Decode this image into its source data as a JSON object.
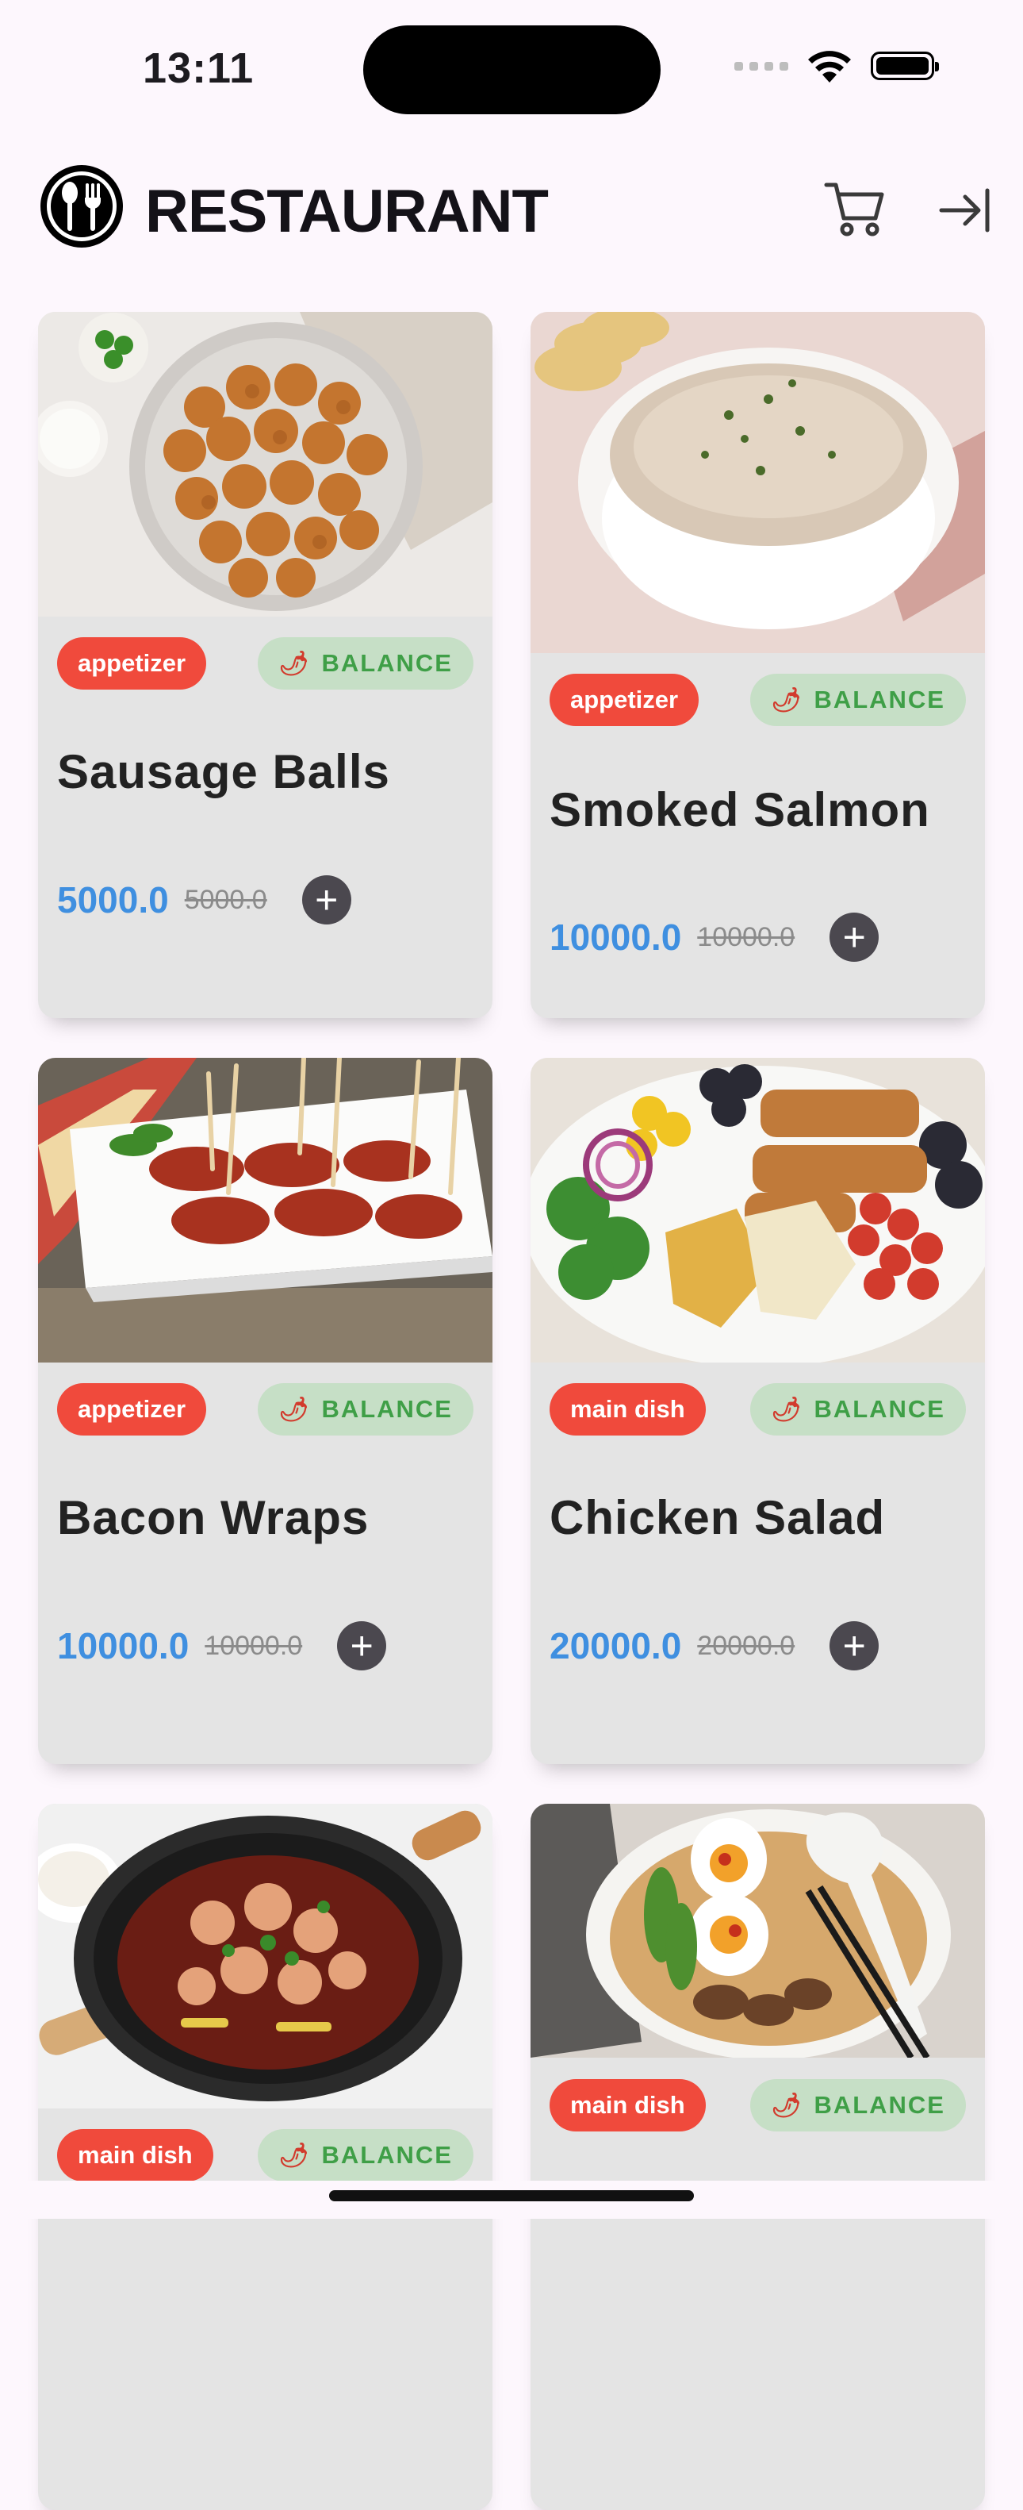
{
  "status_bar": {
    "time": "13:11"
  },
  "header": {
    "title": "RESTAURANT",
    "logo_icon": "restaurant-logo-icon",
    "cart_icon": "cart-icon",
    "logout_icon": "logout-icon"
  },
  "colors": {
    "background": "#fdf7fd",
    "card": "#e4e4e4",
    "category_badge": "#f04a3c",
    "balance_badge_bg": "#c6dfc6",
    "balance_badge_text": "#3f9f47",
    "price": "#3f8fe0"
  },
  "dishes": [
    {
      "category": "appetizer",
      "tag": "BALANCE",
      "name": "Sausage Balls",
      "price": "5000.0",
      "old_price": "5000.0"
    },
    {
      "category": "appetizer",
      "tag": "BALANCE",
      "name": "Smoked Salmon",
      "price": "10000.0",
      "old_price": "10000.0"
    },
    {
      "category": "appetizer",
      "tag": "BALANCE",
      "name": "Bacon Wraps",
      "price": "10000.0",
      "old_price": "10000.0"
    },
    {
      "category": "main dish",
      "tag": "BALANCE",
      "name": "Chicken Salad",
      "price": "20000.0",
      "old_price": "20000.0"
    },
    {
      "category": "main dish",
      "tag": "BALANCE"
    },
    {
      "category": "main dish",
      "tag": "BALANCE"
    }
  ]
}
